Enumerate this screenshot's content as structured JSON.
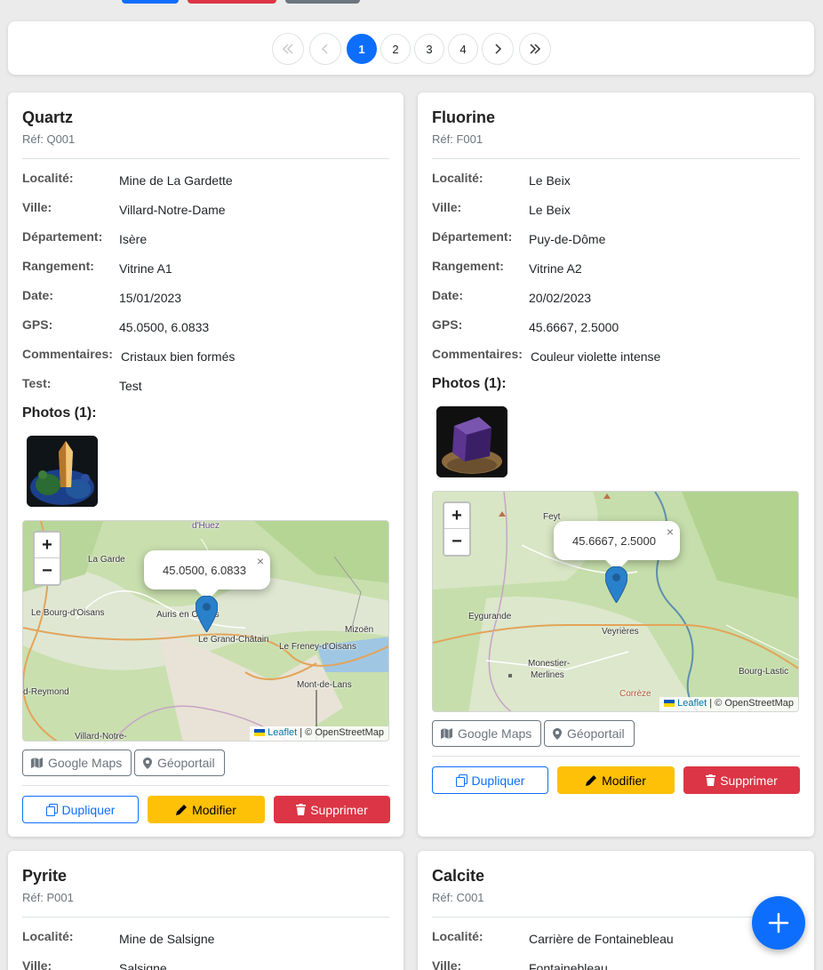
{
  "top_buttons": {
    "colors": [
      "#0d6efd",
      "#dc3545",
      "#6c757d"
    ]
  },
  "pagination": {
    "first_icon": "double-chevron-left-icon",
    "prev_icon": "chevron-left-icon",
    "pages": [
      "1",
      "2",
      "3",
      "4"
    ],
    "current": "1",
    "next_icon": "chevron-right-icon",
    "last_icon": "double-chevron-right-icon"
  },
  "labels": {
    "localite": "Localité:",
    "ville": "Ville:",
    "departement": "Département:",
    "rangement": "Rangement:",
    "date": "Date:",
    "gps": "GPS:",
    "commentaires": "Commentaires:",
    "test": "Test:",
    "google_maps": "Google Maps",
    "geoportail": "Géoportail",
    "dupliquer": "Dupliquer",
    "modifier": "Modifier",
    "supprimer": "Supprimer",
    "leaflet": "Leaflet",
    "osm": "| © OpenStreetMap",
    "popup_close": "×",
    "zoom_in": "+",
    "zoom_out": "−"
  },
  "cards": [
    {
      "name": "Quartz",
      "ref": "Réf: Q001",
      "localite": "Mine de La Gardette",
      "ville": "Villard-Notre-Dame",
      "departement": "Isère",
      "rangement": "Vitrine A1",
      "date": "15/01/2023",
      "gps": "45.0500, 6.0833",
      "commentaires": "Cristaux bien formés",
      "test": "Test",
      "photos_title": "Photos (1):",
      "map_popup": "45.0500, 6.0833",
      "map_places": [
        "d'Huez",
        "La Garde",
        "Le Bourg-d'Oisans",
        "Auris en Oisans",
        "Le Grand-Châtain",
        "Mizoën",
        "Le Freney-d'Oisans",
        "Mont-de-Lans",
        "d-Reymond",
        "Villard-Notre-"
      ]
    },
    {
      "name": "Fluorine",
      "ref": "Réf: F001",
      "localite": "Le Beix",
      "ville": "Le Beix",
      "departement": "Puy-de-Dôme",
      "rangement": "Vitrine A2",
      "date": "20/02/2023",
      "gps": "45.6667, 2.5000",
      "commentaires": "Couleur violette intense",
      "photos_title": "Photos (1):",
      "map_popup": "45.6667, 2.5000",
      "map_places": [
        "Feyt",
        "Eygurande",
        "Veyrières",
        "Monestier-",
        "Merlines",
        "Bourg-Lastic",
        "Corrèze"
      ]
    },
    {
      "name": "Pyrite",
      "ref": "Réf: P001",
      "localite": "Mine de Salsigne",
      "ville": "Salsigne"
    },
    {
      "name": "Calcite",
      "ref": "Réf: C001",
      "localite": "Carrière de Fontainebleau",
      "ville": "Fontainebleau"
    }
  ],
  "fab": {
    "icon": "plus-icon"
  }
}
